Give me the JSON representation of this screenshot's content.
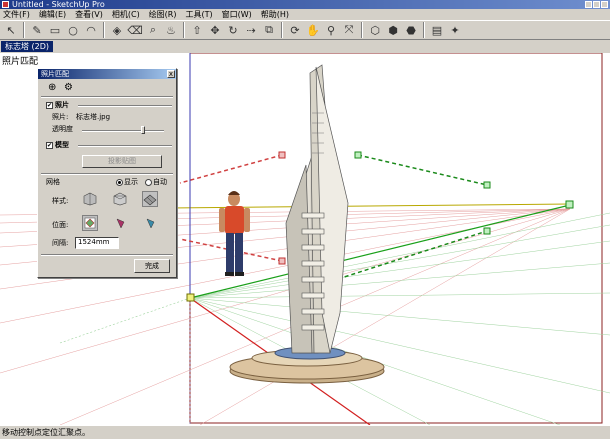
{
  "window": {
    "title": "Untitled - SketchUp Pro"
  },
  "menu": [
    "文件(F)",
    "编辑(E)",
    "查看(V)",
    "相机(C)",
    "绘图(R)",
    "工具(T)",
    "窗口(W)",
    "帮助(H)"
  ],
  "scene_tab": "标志塔 (2D)",
  "viewport_label": "照片匹配",
  "dialog": {
    "title": "照片匹配",
    "close": "x",
    "photo_section": "照片",
    "photo_label": "照片:",
    "photo_file": "标志塔.jpg",
    "transparency_label": "透明度",
    "transparency_value": 0.75,
    "model_section": "模型",
    "project_button": "投影贴图",
    "grid_label": "网格",
    "show_radio": "显示",
    "auto_radio": "自动",
    "style_label": "样式:",
    "plane_label": "位面:",
    "spacing_label": "间隔:",
    "spacing_value": "1524mm",
    "done_button": "完成"
  },
  "status_text": "移动控制点定位汇聚点。",
  "colors": {
    "red_axis": "#d22020",
    "green_axis": "#1aa01a",
    "horizon": "#b8a800",
    "grid_red": "#e08a8a",
    "grid_green": "#8ac88a"
  }
}
